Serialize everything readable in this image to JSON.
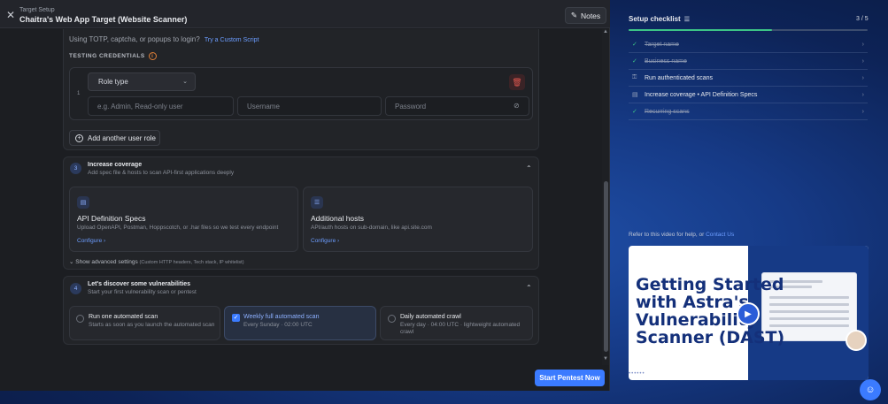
{
  "header": {
    "subtitle": "Target Setup",
    "title": "Chaitra's Web App Target (Website Scanner)",
    "notes_label": "Notes"
  },
  "auth": {
    "totp_question": "Using TOTP, captcha, or popups to login?",
    "totp_link": "Try a Custom Script",
    "credentials_label": "TESTING CREDENTIALS",
    "row_number": "1",
    "role_select_value": "Role type",
    "role_placeholder": "e.g. Admin, Read-only user",
    "username_placeholder": "Username",
    "password_placeholder": "Password",
    "add_role_label": "Add another user role"
  },
  "coverage": {
    "step": "3",
    "title": "Increase coverage",
    "subtitle": "Add spec file & hosts to scan API-first applications deeply",
    "cards": [
      {
        "title": "API Definition Specs",
        "desc": "Upload OpenAPI, Postman, Hoppscotch, or .har files so we test every endpoint",
        "link": "Configure"
      },
      {
        "title": "Additional hosts",
        "desc": "API/auth hosts on sub-domain, like api.site.com",
        "link": "Configure"
      }
    ],
    "advanced_label": "Show advanced settings",
    "advanced_hint": "(Custom HTTP headers, Tech stack, IP whitelist)"
  },
  "discover": {
    "step": "4",
    "title": "Let's discover some vulnerabilities",
    "subtitle": "Start your first vulnerability scan or pentest",
    "options": [
      {
        "title": "Run one automated scan",
        "sub": "Starts as soon as you launch the automated scan",
        "selected": false
      },
      {
        "title": "Weekly full automated scan",
        "sub": "Every Sunday · 02:00 UTC",
        "selected": true
      },
      {
        "title": "Daily automated crawl",
        "sub": "Every day · 04:00 UTC · lightweight automated crawl",
        "selected": false
      }
    ]
  },
  "start_button": "Start Pentest Now",
  "checklist": {
    "title": "Setup checklist",
    "count": "3 / 5",
    "progress": 0.6,
    "items": [
      {
        "label": "Target name",
        "done": true
      },
      {
        "label": "Business name",
        "done": true
      },
      {
        "label": "Run authenticated scans",
        "done": false
      },
      {
        "label": "Increase coverage • API Definition Specs",
        "done": false
      },
      {
        "label": "Recurring scans",
        "done": true
      }
    ]
  },
  "help": {
    "text": "Refer to this video for help, or",
    "link": "Contact Us"
  },
  "video": {
    "title": "Getting Started with Astra's Vulnerability Scanner (DAST)",
    "title_lines": [
      "Getting Started",
      "with Astra's",
      "Vulnerability",
      "Scanner (DAST)"
    ]
  },
  "colors": {
    "accent": "#3b7bff",
    "success": "#3cc486",
    "danger": "#e0574f"
  }
}
